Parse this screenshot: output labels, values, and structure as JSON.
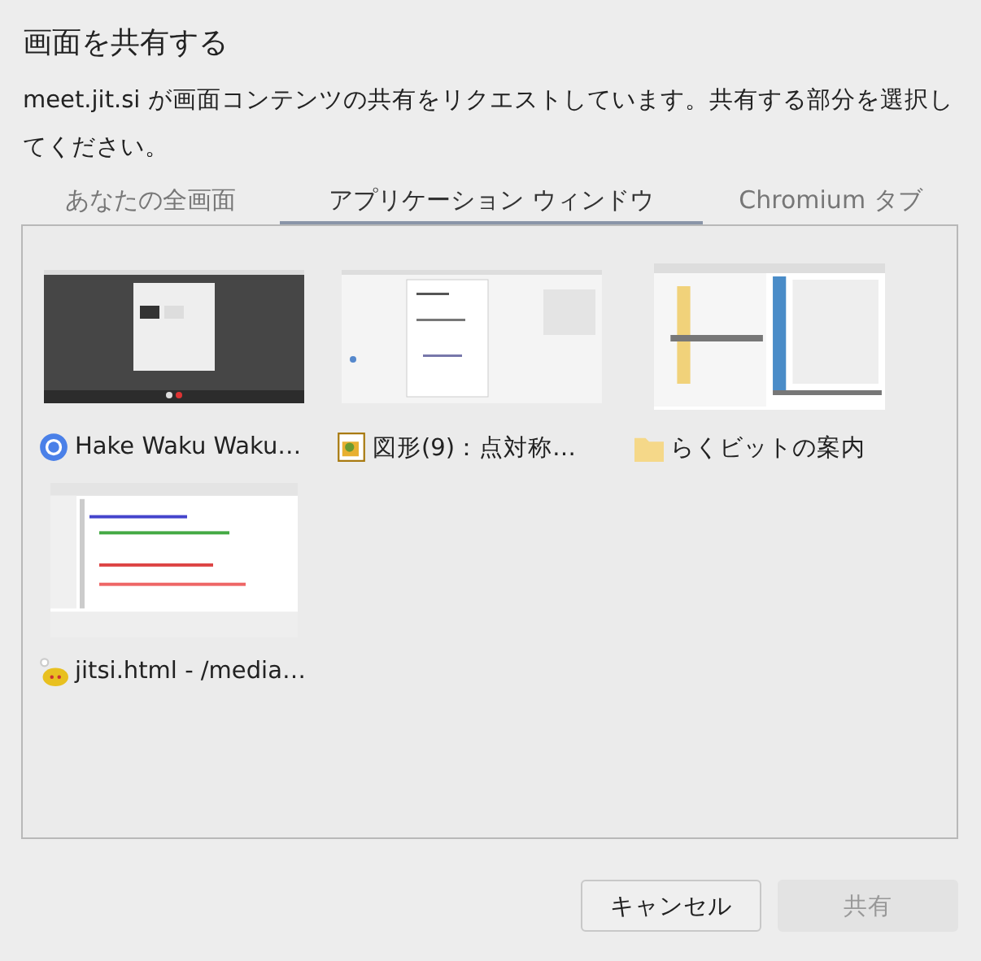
{
  "dialog": {
    "title": "画面を共有する",
    "message": "meet.jit.si が画面コンテンツの共有をリクエストしています。共有する部分を選択してください。"
  },
  "tabs": [
    {
      "label": "あなたの全画面",
      "selected": false
    },
    {
      "label": "アプリケーション ウィンドウ",
      "selected": true
    },
    {
      "label": "Chromium タブ",
      "selected": false
    }
  ],
  "windows": [
    {
      "label": "Hake Waku Waku…"
    },
    {
      "label": "図形(9)：点対称…"
    },
    {
      "label": "らくビットの案内"
    },
    {
      "label": "jitsi.html - /media…"
    }
  ],
  "buttons": [
    {
      "label": "キャンセル",
      "disabled": false
    },
    {
      "label": "共有",
      "disabled": true
    }
  ]
}
